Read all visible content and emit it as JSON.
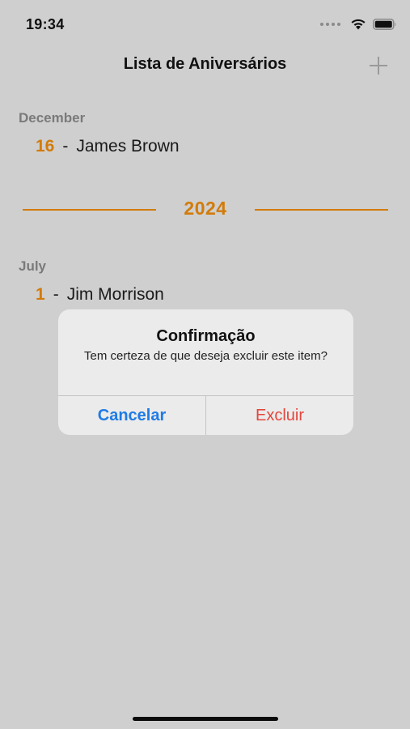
{
  "status_bar": {
    "time": "19:34",
    "icons": [
      "signal-dots-icon",
      "wifi-icon",
      "battery-icon"
    ]
  },
  "nav": {
    "title": "Lista de Aniversários",
    "add_icon": "plus-icon"
  },
  "sections": [
    {
      "month": "December",
      "items": [
        {
          "day": "16",
          "separator": "-",
          "name": "James Brown"
        }
      ]
    },
    {
      "month": "July",
      "items": [
        {
          "day": "1",
          "separator": "-",
          "name": "Jim Morrison"
        }
      ]
    }
  ],
  "year_divider": {
    "year": "2024"
  },
  "alert": {
    "title": "Confirmação",
    "message": "Tem certeza de que deseja excluir este item?",
    "cancel_label": "Cancelar",
    "confirm_label": "Excluir"
  },
  "colors": {
    "accent": "#d27b0b",
    "background": "#cfcfcf",
    "alert_background": "#ebebeb",
    "cancel": "#1e7be6",
    "destructive": "#e5463c"
  }
}
